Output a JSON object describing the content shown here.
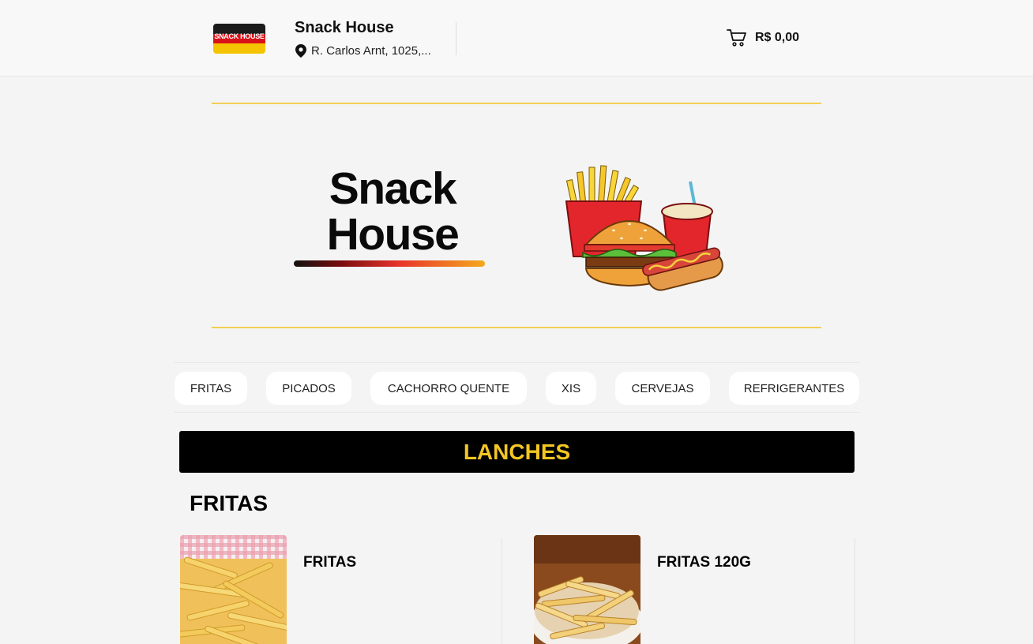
{
  "header": {
    "logo_text": "SNACK HOUSE",
    "store_name": "Snack House",
    "address": "R. Carlos Arnt, 1025,...",
    "cart_total": "R$ 0,00"
  },
  "hero": {
    "title_line1": "Snack",
    "title_line2": "House"
  },
  "categories": [
    "FRITAS",
    "PICADOS",
    "CACHORRO QUENTE",
    "XIS",
    "CERVEJAS",
    "REFRIGERANTES"
  ],
  "section": {
    "title": "LANCHES",
    "subsection": "FRITAS"
  },
  "products": [
    {
      "name": "FRITAS"
    },
    {
      "name": "FRITAS 120G"
    }
  ],
  "colors": {
    "accent_yellow": "#f3c623",
    "banner_bg": "#000000",
    "background": "#f4f4f4"
  },
  "icons": [
    "location-pin-icon",
    "cart-icon"
  ]
}
